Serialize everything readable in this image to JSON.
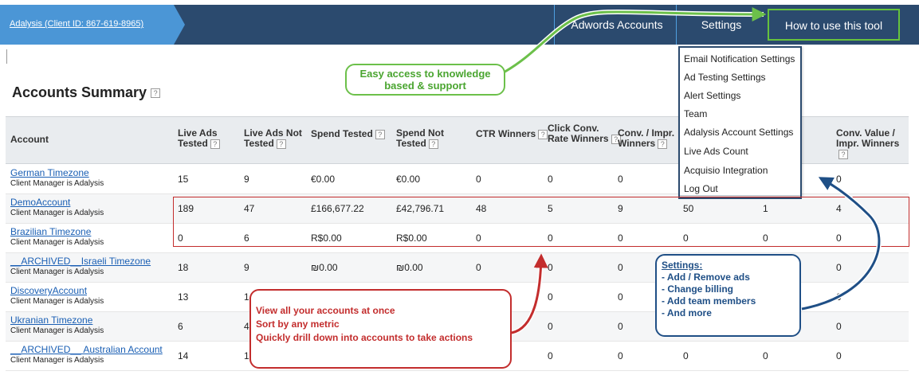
{
  "header": {
    "client_tag": "Adalysis (Client ID: 867-619-8965)",
    "nav": {
      "adwords": "Adwords Accounts",
      "settings": "Settings",
      "howto": "How to use this tool"
    }
  },
  "page_title": "Accounts Summary",
  "help_glyph": "?",
  "table": {
    "columns": [
      {
        "l1": "Account",
        "l2": "",
        "help": false
      },
      {
        "l1": "Live Ads",
        "l2": "Tested",
        "help": true
      },
      {
        "l1": "Live Ads Not",
        "l2": "Tested",
        "help": true
      },
      {
        "l1": "Spend Tested",
        "l2": "",
        "help": true
      },
      {
        "l1": "Spend Not",
        "l2": "Tested",
        "help": true
      },
      {
        "l1": "CTR Winners",
        "l2": "",
        "help": true
      },
      {
        "l1": "Click Conv.",
        "l2": "Rate Winners",
        "help": true
      },
      {
        "l1": "Conv. / Impr.",
        "l2": "Winners",
        "help": true
      },
      {
        "l1": "",
        "l2": "",
        "help": false
      },
      {
        "l1": "lue /",
        "l2": "ners",
        "help": false
      },
      {
        "l1": "Conv. Value /",
        "l2": "Impr. Winners",
        "help": true
      }
    ],
    "rows": [
      {
        "name": "German Timezone",
        "sub": "Client Manager is Adalysis",
        "cells": [
          "15",
          "9",
          "€0.00",
          "€0.00",
          "0",
          "0",
          "0",
          "",
          "",
          "0"
        ]
      },
      {
        "name": "DemoAccount",
        "sub": "Client Manager is Adalysis",
        "cells": [
          "189",
          "47",
          "£166,677.22",
          "£42,796.71",
          "48",
          "5",
          "9",
          "50",
          "1",
          "4"
        ]
      },
      {
        "name": "Brazilian Timezone",
        "sub": "Client Manager is Adalysis",
        "cells": [
          "0",
          "6",
          "R$0.00",
          "R$0.00",
          "0",
          "0",
          "0",
          "0",
          "0",
          "0"
        ]
      },
      {
        "name": "__ARCHIVED__Israeli Timezone",
        "sub": "Client Manager is Adalysis",
        "cells": [
          "18",
          "9",
          "₪0.00",
          "₪0.00",
          "0",
          "0",
          "0",
          "",
          "",
          "0"
        ]
      },
      {
        "name": "DiscoveryAccount",
        "sub": "Client Manager is Adalysis",
        "cells": [
          "13",
          "14",
          "",
          "",
          "",
          "0",
          "0",
          "",
          "",
          "0"
        ]
      },
      {
        "name": "Ukranian Timezone",
        "sub": "Client Manager is Adalysis",
        "cells": [
          "6",
          "4",
          "",
          "",
          "",
          "0",
          "0",
          "",
          "",
          "0"
        ]
      },
      {
        "name": "__ARCHIVED__ Australian Account",
        "sub": "Client Manager is Adalysis",
        "cells": [
          "14",
          "1",
          "",
          "",
          "",
          "0",
          "0",
          "0",
          "0",
          "0"
        ]
      }
    ]
  },
  "settings_menu": [
    "Email Notification Settings",
    "Ad Testing Settings",
    "Alert Settings",
    "Team",
    "Adalysis Account Settings",
    "Live Ads Count",
    "Acquisio Integration",
    "Log Out"
  ],
  "callouts": {
    "green": [
      "Easy access to knowledge",
      "based & support"
    ],
    "blue_title": "Settings:",
    "blue": [
      "- Add / Remove ads",
      "- Change billing",
      "- Add team members",
      "- And more"
    ],
    "red": [
      "View all your accounts at once",
      "Sort by any metric",
      "Quickly drill down into accounts to take actions"
    ]
  },
  "colors": {
    "nav_bg": "#2b4a6e",
    "client_tag": "#4b96d6",
    "green": "#6cc04a",
    "red": "#c32d2d",
    "blue": "#1f4f86"
  }
}
